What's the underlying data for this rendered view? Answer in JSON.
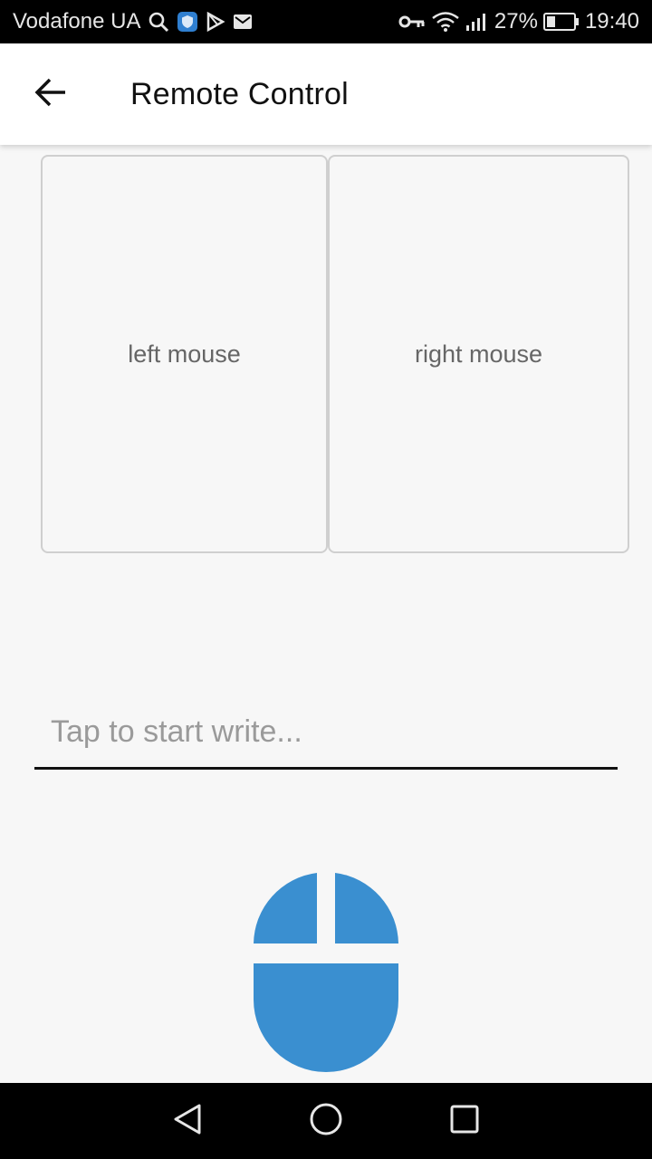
{
  "status_bar": {
    "carrier": "Vodafone UA",
    "battery_percent": "27%",
    "time": "19:40",
    "icons": [
      "search-icon",
      "shield-icon",
      "play-store-icon",
      "mail-icon",
      "key-icon",
      "wifi-icon",
      "signal-icon",
      "battery-icon"
    ]
  },
  "app_bar": {
    "back_icon": "arrow-left-icon",
    "title": "Remote Control"
  },
  "pads": {
    "left_label": "left mouse",
    "right_label": "right mouse"
  },
  "text_input": {
    "value": "",
    "placeholder": "Tap to start write..."
  },
  "mouse": {
    "icon": "mouse-icon",
    "color": "#3a8fd0"
  },
  "nav_bar": {
    "icons": [
      "back-triangle-icon",
      "home-circle-icon",
      "recents-square-icon"
    ]
  }
}
